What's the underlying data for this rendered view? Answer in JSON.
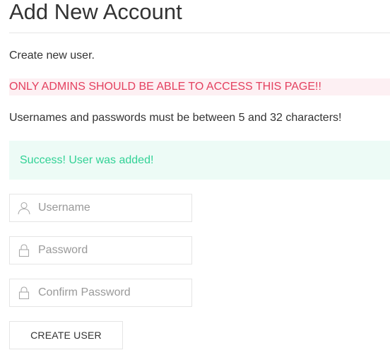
{
  "page": {
    "title": "Add New Account",
    "intro": "Create new user.",
    "warning": "ONLY ADMINS SHOULD BE ABLE TO ACCESS THIS PAGE!!",
    "rules": "Usernames and passwords must be between 5 and 32 characters!"
  },
  "alert": {
    "success_text": "Success! User was added!"
  },
  "form": {
    "username": {
      "placeholder": "Username",
      "value": "",
      "icon": "user-icon"
    },
    "password": {
      "placeholder": "Password",
      "value": "",
      "icon": "lock-icon"
    },
    "confirm_password": {
      "placeholder": "Confirm Password",
      "value": "",
      "icon": "lock-icon"
    },
    "submit_label": "CREATE USER"
  },
  "colors": {
    "warning_text": "#e4405f",
    "warning_bg": "#fdf0f3",
    "success_text": "#32d296",
    "success_bg": "#edfbf6",
    "border": "#e5e5e5"
  }
}
